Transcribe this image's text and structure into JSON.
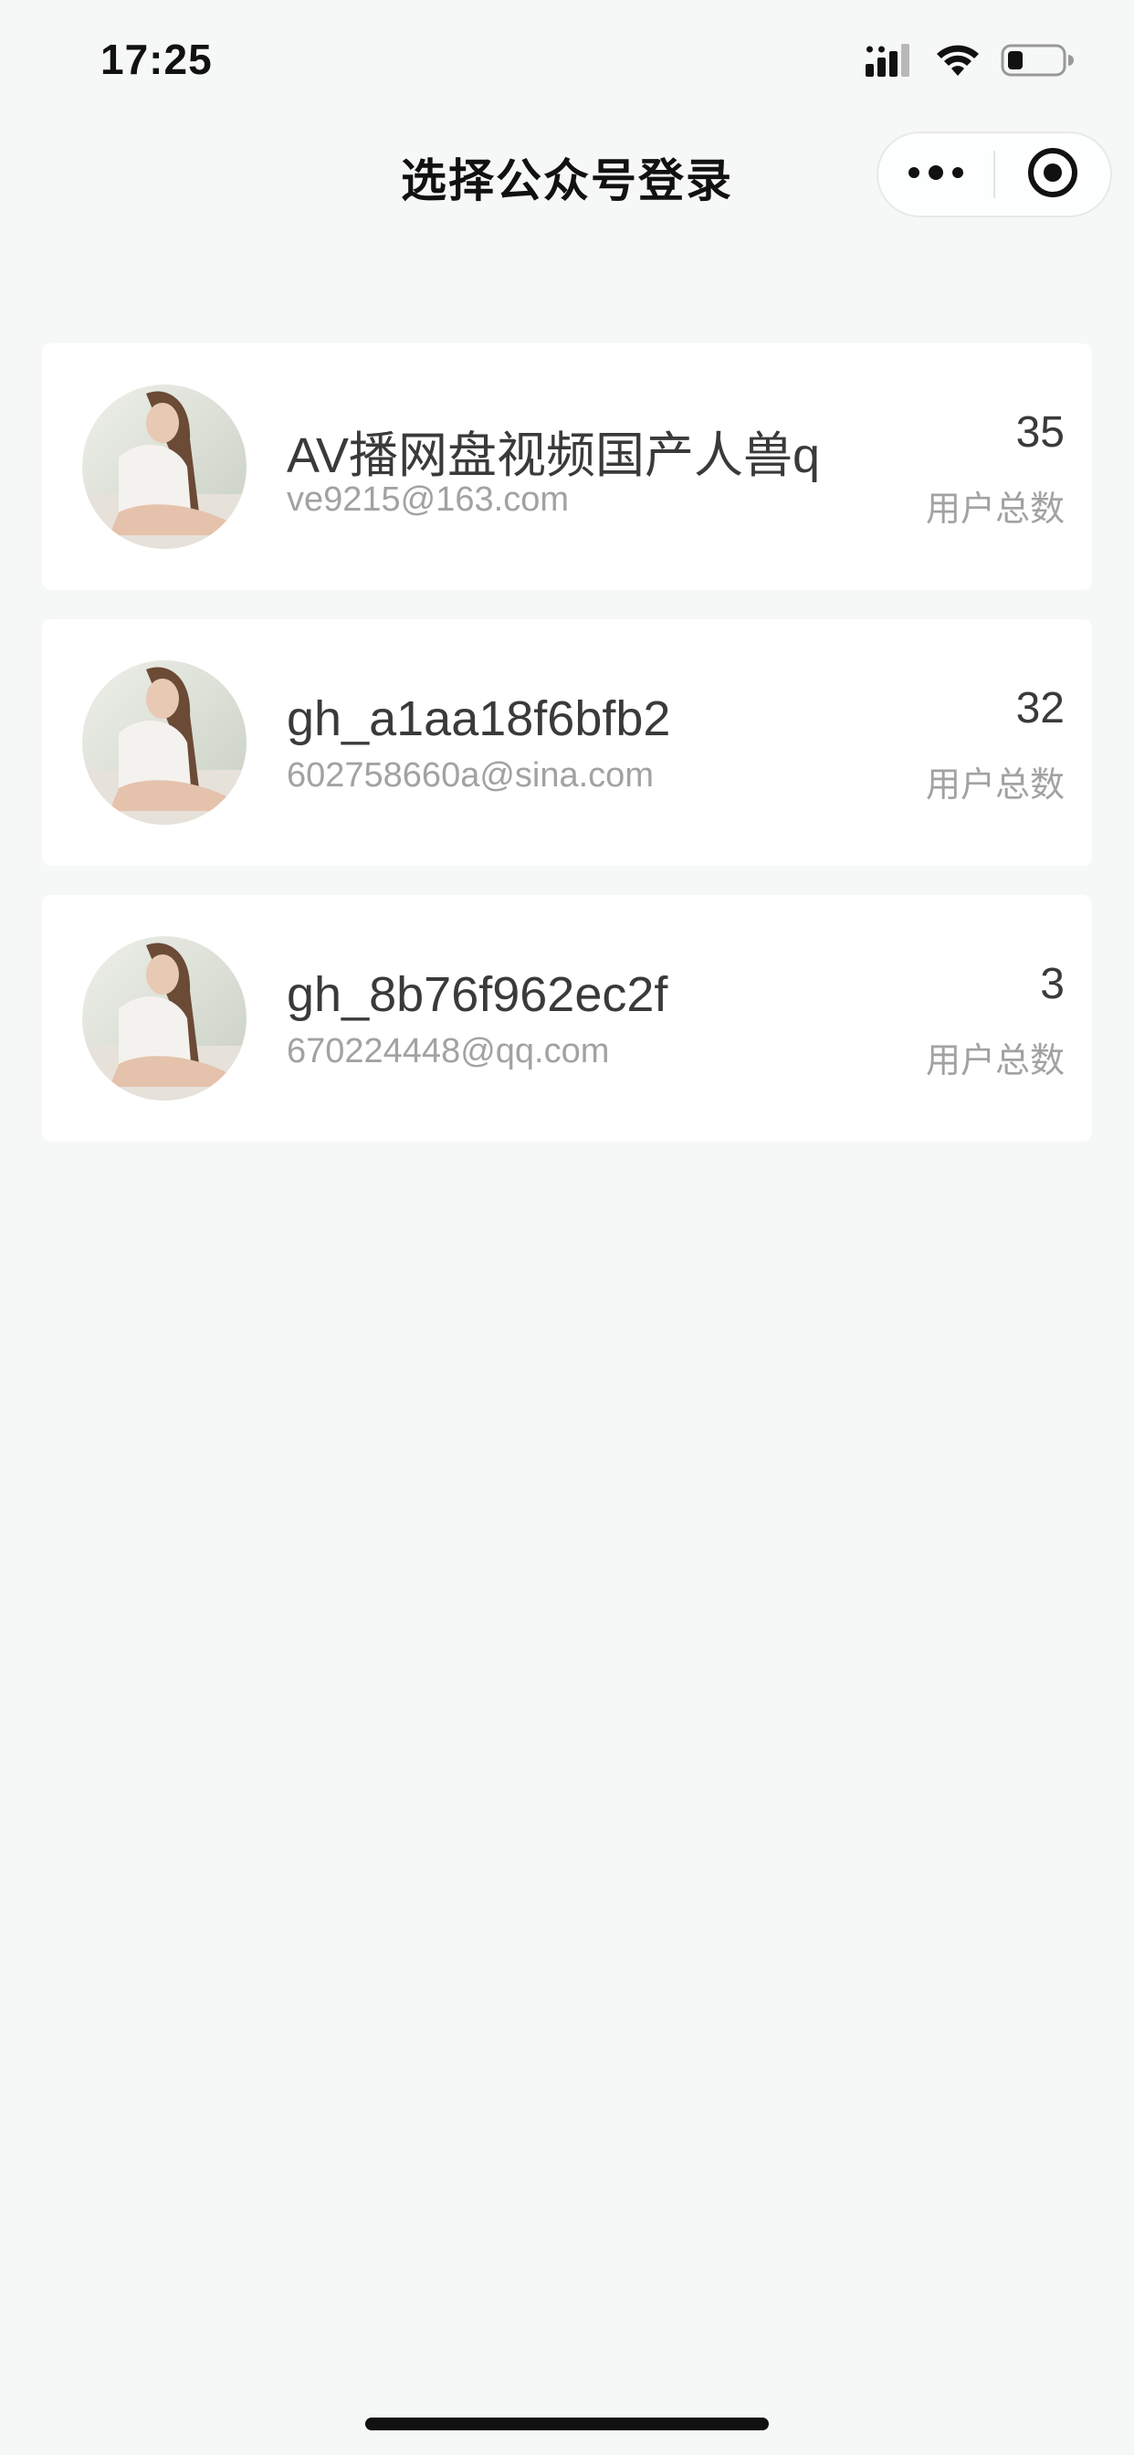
{
  "status_bar": {
    "time": "17:25",
    "signal_icon": "cellular-signal-icon",
    "wifi_icon": "wifi-icon",
    "battery_icon": "battery-low-icon"
  },
  "nav": {
    "title": "选择公众号登录",
    "more_icon": "more-dots-icon",
    "close_icon": "target-close-icon"
  },
  "accounts": [
    {
      "name": "AV播网盘视频国产人兽q",
      "email": "ve9215@163.com",
      "user_count": "35",
      "user_count_label": "用户总数",
      "avatar_icon": "avatar-photo"
    },
    {
      "name": "gh_a1aa18f6bfb2",
      "email": "602758660a@sina.com",
      "user_count": "32",
      "user_count_label": "用户总数",
      "avatar_icon": "avatar-photo"
    },
    {
      "name": "gh_8b76f962ec2f",
      "email": "670224448@qq.com",
      "user_count": "3",
      "user_count_label": "用户总数",
      "avatar_icon": "avatar-photo"
    }
  ],
  "colors": {
    "page_background": "#f6f8f7",
    "card_background": "#ffffff",
    "primary_text": "#3a3a3a",
    "secondary_text": "#a2a2a2"
  }
}
